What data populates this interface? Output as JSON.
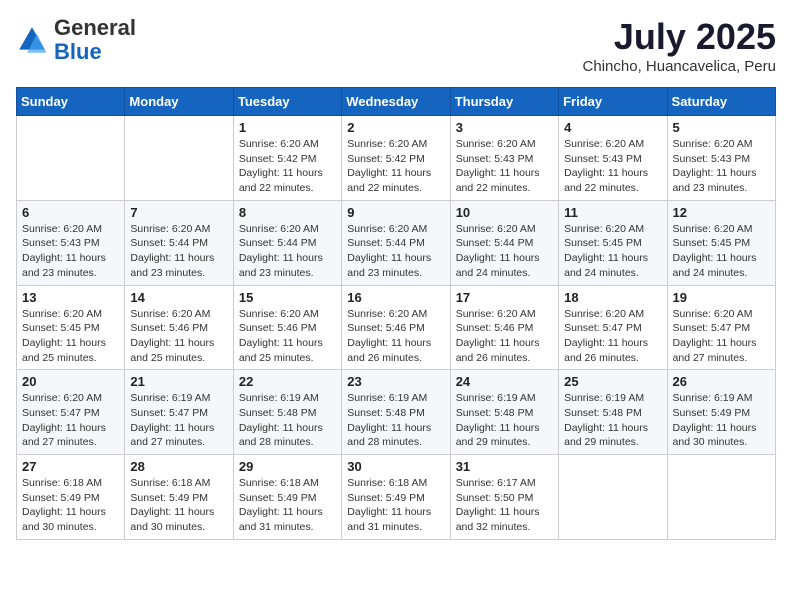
{
  "header": {
    "logo": {
      "general": "General",
      "blue": "Blue"
    },
    "title": "July 2025",
    "location": "Chincho, Huancavelica, Peru"
  },
  "weekdays": [
    "Sunday",
    "Monday",
    "Tuesday",
    "Wednesday",
    "Thursday",
    "Friday",
    "Saturday"
  ],
  "weeks": [
    [
      {
        "day": "",
        "info": ""
      },
      {
        "day": "",
        "info": ""
      },
      {
        "day": "1",
        "info": "Sunrise: 6:20 AM\nSunset: 5:42 PM\nDaylight: 11 hours\nand 22 minutes."
      },
      {
        "day": "2",
        "info": "Sunrise: 6:20 AM\nSunset: 5:42 PM\nDaylight: 11 hours\nand 22 minutes."
      },
      {
        "day": "3",
        "info": "Sunrise: 6:20 AM\nSunset: 5:43 PM\nDaylight: 11 hours\nand 22 minutes."
      },
      {
        "day": "4",
        "info": "Sunrise: 6:20 AM\nSunset: 5:43 PM\nDaylight: 11 hours\nand 22 minutes."
      },
      {
        "day": "5",
        "info": "Sunrise: 6:20 AM\nSunset: 5:43 PM\nDaylight: 11 hours\nand 23 minutes."
      }
    ],
    [
      {
        "day": "6",
        "info": "Sunrise: 6:20 AM\nSunset: 5:43 PM\nDaylight: 11 hours\nand 23 minutes."
      },
      {
        "day": "7",
        "info": "Sunrise: 6:20 AM\nSunset: 5:44 PM\nDaylight: 11 hours\nand 23 minutes."
      },
      {
        "day": "8",
        "info": "Sunrise: 6:20 AM\nSunset: 5:44 PM\nDaylight: 11 hours\nand 23 minutes."
      },
      {
        "day": "9",
        "info": "Sunrise: 6:20 AM\nSunset: 5:44 PM\nDaylight: 11 hours\nand 23 minutes."
      },
      {
        "day": "10",
        "info": "Sunrise: 6:20 AM\nSunset: 5:44 PM\nDaylight: 11 hours\nand 24 minutes."
      },
      {
        "day": "11",
        "info": "Sunrise: 6:20 AM\nSunset: 5:45 PM\nDaylight: 11 hours\nand 24 minutes."
      },
      {
        "day": "12",
        "info": "Sunrise: 6:20 AM\nSunset: 5:45 PM\nDaylight: 11 hours\nand 24 minutes."
      }
    ],
    [
      {
        "day": "13",
        "info": "Sunrise: 6:20 AM\nSunset: 5:45 PM\nDaylight: 11 hours\nand 25 minutes."
      },
      {
        "day": "14",
        "info": "Sunrise: 6:20 AM\nSunset: 5:46 PM\nDaylight: 11 hours\nand 25 minutes."
      },
      {
        "day": "15",
        "info": "Sunrise: 6:20 AM\nSunset: 5:46 PM\nDaylight: 11 hours\nand 25 minutes."
      },
      {
        "day": "16",
        "info": "Sunrise: 6:20 AM\nSunset: 5:46 PM\nDaylight: 11 hours\nand 26 minutes."
      },
      {
        "day": "17",
        "info": "Sunrise: 6:20 AM\nSunset: 5:46 PM\nDaylight: 11 hours\nand 26 minutes."
      },
      {
        "day": "18",
        "info": "Sunrise: 6:20 AM\nSunset: 5:47 PM\nDaylight: 11 hours\nand 26 minutes."
      },
      {
        "day": "19",
        "info": "Sunrise: 6:20 AM\nSunset: 5:47 PM\nDaylight: 11 hours\nand 27 minutes."
      }
    ],
    [
      {
        "day": "20",
        "info": "Sunrise: 6:20 AM\nSunset: 5:47 PM\nDaylight: 11 hours\nand 27 minutes."
      },
      {
        "day": "21",
        "info": "Sunrise: 6:19 AM\nSunset: 5:47 PM\nDaylight: 11 hours\nand 27 minutes."
      },
      {
        "day": "22",
        "info": "Sunrise: 6:19 AM\nSunset: 5:48 PM\nDaylight: 11 hours\nand 28 minutes."
      },
      {
        "day": "23",
        "info": "Sunrise: 6:19 AM\nSunset: 5:48 PM\nDaylight: 11 hours\nand 28 minutes."
      },
      {
        "day": "24",
        "info": "Sunrise: 6:19 AM\nSunset: 5:48 PM\nDaylight: 11 hours\nand 29 minutes."
      },
      {
        "day": "25",
        "info": "Sunrise: 6:19 AM\nSunset: 5:48 PM\nDaylight: 11 hours\nand 29 minutes."
      },
      {
        "day": "26",
        "info": "Sunrise: 6:19 AM\nSunset: 5:49 PM\nDaylight: 11 hours\nand 30 minutes."
      }
    ],
    [
      {
        "day": "27",
        "info": "Sunrise: 6:18 AM\nSunset: 5:49 PM\nDaylight: 11 hours\nand 30 minutes."
      },
      {
        "day": "28",
        "info": "Sunrise: 6:18 AM\nSunset: 5:49 PM\nDaylight: 11 hours\nand 30 minutes."
      },
      {
        "day": "29",
        "info": "Sunrise: 6:18 AM\nSunset: 5:49 PM\nDaylight: 11 hours\nand 31 minutes."
      },
      {
        "day": "30",
        "info": "Sunrise: 6:18 AM\nSunset: 5:49 PM\nDaylight: 11 hours\nand 31 minutes."
      },
      {
        "day": "31",
        "info": "Sunrise: 6:17 AM\nSunset: 5:50 PM\nDaylight: 11 hours\nand 32 minutes."
      },
      {
        "day": "",
        "info": ""
      },
      {
        "day": "",
        "info": ""
      }
    ]
  ]
}
